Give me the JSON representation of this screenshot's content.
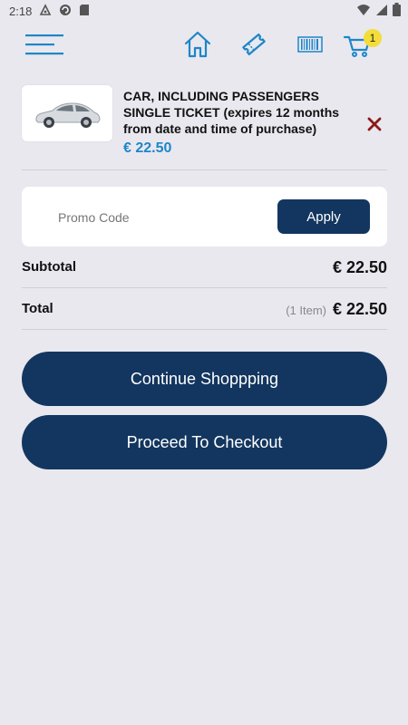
{
  "status_bar": {
    "time": "2:18"
  },
  "nav": {
    "cart_count": "1"
  },
  "cart_item": {
    "title": "CAR, INCLUDING PASSENGERS SINGLE TICKET (expires 12 months from date and time of purchase)",
    "price": "€ 22.50"
  },
  "promo": {
    "placeholder": "Promo Code",
    "value": "",
    "apply_label": "Apply"
  },
  "summary": {
    "subtotal_label": "Subtotal",
    "subtotal_value": "€ 22.50",
    "total_label": "Total",
    "item_count": "(1 Item)",
    "total_value": "€ 22.50"
  },
  "actions": {
    "continue_label": "Continue Shoppping",
    "checkout_label": "Proceed To Checkout"
  },
  "colors": {
    "background": "#e9e8ef",
    "brand_navy": "#12365f",
    "icon_blue": "#1e86c8",
    "price_blue": "#1e86c8",
    "badge_yellow": "#f3dd3a",
    "remove_red": "#8b1a1a"
  }
}
